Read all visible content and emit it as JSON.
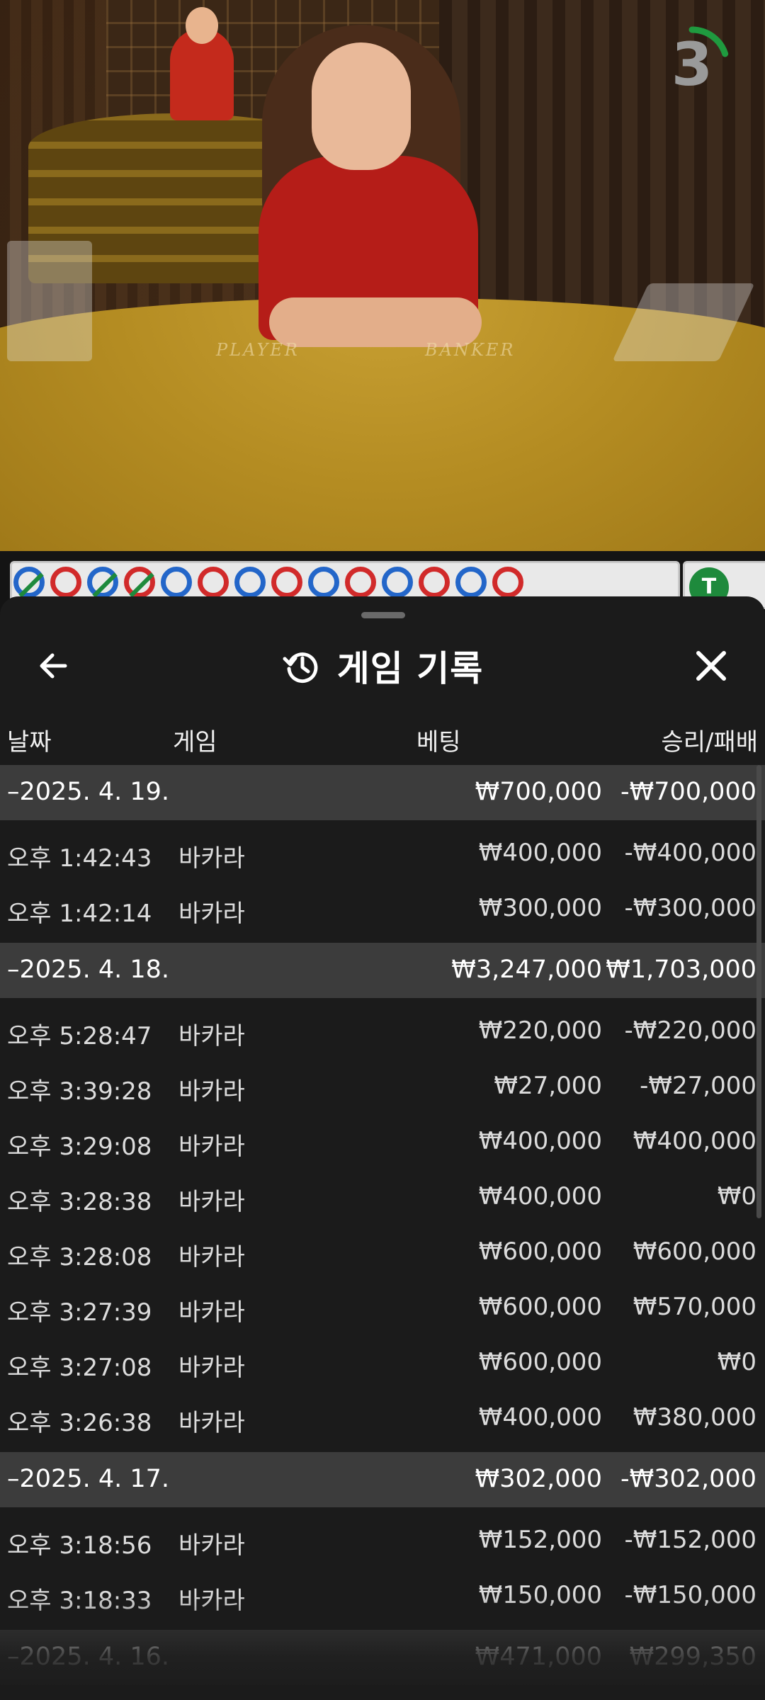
{
  "video": {
    "countdown": "3",
    "countdown_fraction": 0.2,
    "table_labels": [
      "PLAYER",
      "BANKER"
    ]
  },
  "bead_road": [
    {
      "result": "P",
      "tie": true
    },
    {
      "result": "B",
      "tie": false
    },
    {
      "result": "P",
      "tie": true
    },
    {
      "result": "B",
      "tie": true
    },
    {
      "result": "P",
      "tie": false
    },
    {
      "result": "B",
      "tie": false
    },
    {
      "result": "P",
      "tie": false
    },
    {
      "result": "B",
      "tie": false
    },
    {
      "result": "P",
      "tie": false
    },
    {
      "result": "B",
      "tie": false
    },
    {
      "result": "P",
      "tie": false
    },
    {
      "result": "B",
      "tie": false
    },
    {
      "result": "P",
      "tie": false
    },
    {
      "result": "B",
      "tie": false
    }
  ],
  "side_road": {
    "tie_label": "T"
  },
  "panel": {
    "title": "게임 기록",
    "icons": {
      "back": "arrow-left-icon",
      "history": "history-icon",
      "close": "close-icon"
    },
    "columns": {
      "date": "날짜",
      "game": "게임",
      "bet": "베팅",
      "winloss": "승리/패배"
    },
    "groups": [
      {
        "date": "–2025. 4. 19.",
        "bet": "₩700,000",
        "winloss": "-₩700,000",
        "rows": [
          {
            "time": "오후 1:42:43",
            "game": "바카라",
            "bet": "₩400,000",
            "winloss": "-₩400,000"
          },
          {
            "time": "오후 1:42:14",
            "game": "바카라",
            "bet": "₩300,000",
            "winloss": "-₩300,000"
          }
        ]
      },
      {
        "date": "–2025. 4. 18.",
        "bet": "₩3,247,000",
        "winloss": "₩1,703,000",
        "rows": [
          {
            "time": "오후 5:28:47",
            "game": "바카라",
            "bet": "₩220,000",
            "winloss": "-₩220,000"
          },
          {
            "time": "오후 3:39:28",
            "game": "바카라",
            "bet": "₩27,000",
            "winloss": "-₩27,000"
          },
          {
            "time": "오후 3:29:08",
            "game": "바카라",
            "bet": "₩400,000",
            "winloss": "₩400,000"
          },
          {
            "time": "오후 3:28:38",
            "game": "바카라",
            "bet": "₩400,000",
            "winloss": "₩0"
          },
          {
            "time": "오후 3:28:08",
            "game": "바카라",
            "bet": "₩600,000",
            "winloss": "₩600,000"
          },
          {
            "time": "오후 3:27:39",
            "game": "바카라",
            "bet": "₩600,000",
            "winloss": "₩570,000"
          },
          {
            "time": "오후 3:27:08",
            "game": "바카라",
            "bet": "₩600,000",
            "winloss": "₩0"
          },
          {
            "time": "오후 3:26:38",
            "game": "바카라",
            "bet": "₩400,000",
            "winloss": "₩380,000"
          }
        ]
      },
      {
        "date": "–2025. 4. 17.",
        "bet": "₩302,000",
        "winloss": "-₩302,000",
        "rows": [
          {
            "time": "오후 3:18:56",
            "game": "바카라",
            "bet": "₩152,000",
            "winloss": "-₩152,000"
          },
          {
            "time": "오후 3:18:33",
            "game": "바카라",
            "bet": "₩150,000",
            "winloss": "-₩150,000"
          }
        ]
      },
      {
        "date": "–2025. 4. 16.",
        "bet": "₩471,000",
        "winloss": "₩299,350",
        "rows": []
      }
    ]
  },
  "colors": {
    "banker": "#d12a2a",
    "player": "#2366c9",
    "tie": "#1e8a3c",
    "timer": "#1f9a3f",
    "panel_bg": "#1b1b1b",
    "group_bg": "#3c3c3c"
  }
}
